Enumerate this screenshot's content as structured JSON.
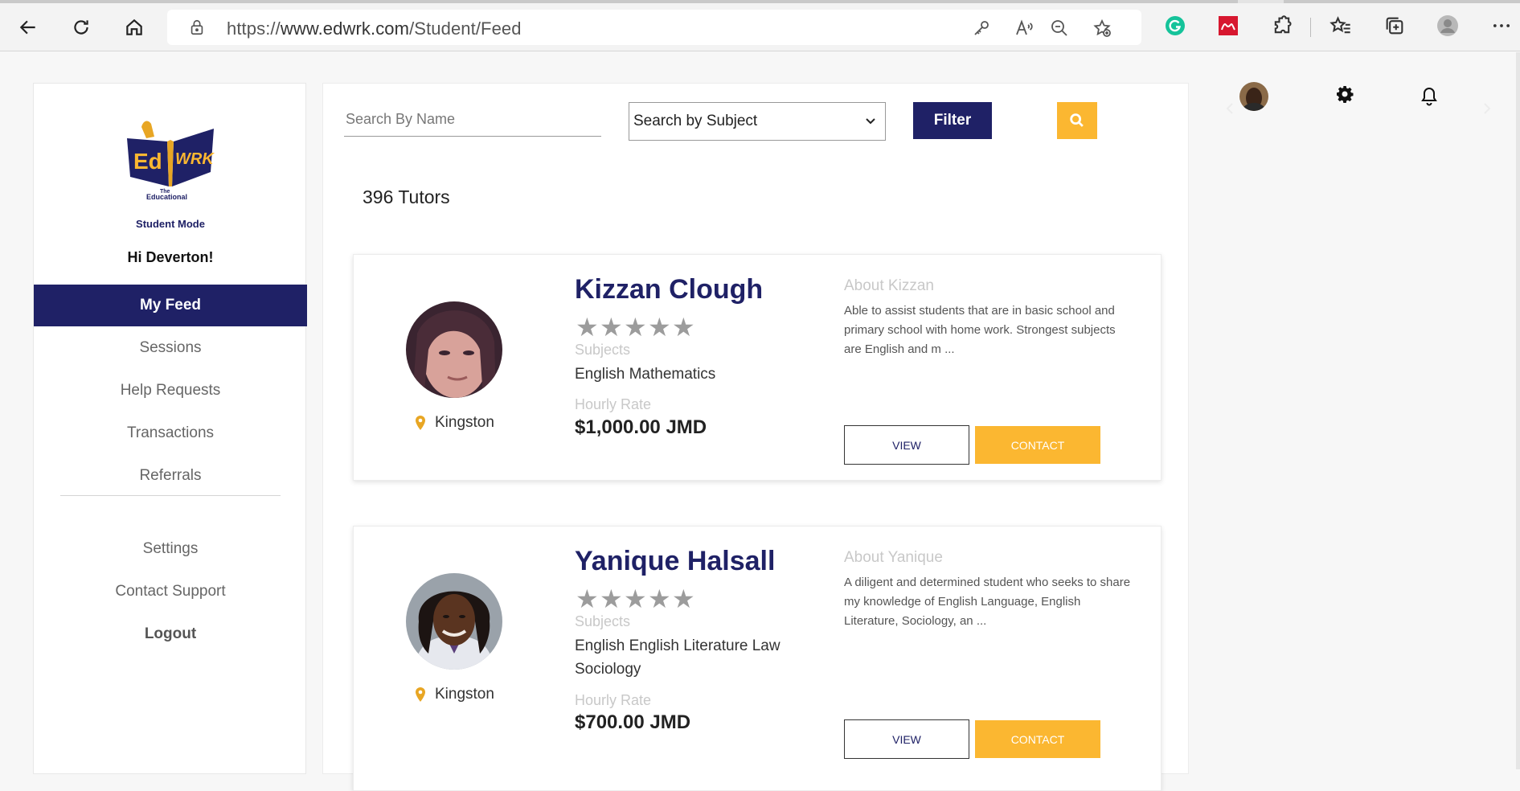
{
  "browser": {
    "url_prefix": "https://",
    "url_host": "www.edwrk.com",
    "url_path": "/Student/Feed"
  },
  "sidebar": {
    "mode_label": "Student Mode",
    "greeting": "Hi Deverton!",
    "items": [
      {
        "label": "My Feed"
      },
      {
        "label": "Sessions"
      },
      {
        "label": "Help Requests"
      },
      {
        "label": "Transactions"
      },
      {
        "label": "Referrals"
      },
      {
        "label": "Settings"
      },
      {
        "label": "Contact Support"
      },
      {
        "label": "Logout"
      }
    ]
  },
  "toolbar": {
    "name_placeholder": "Search By Name",
    "subject_value": "Search by Subject",
    "filter_label": "Filter"
  },
  "feed": {
    "count_label": "396 Tutors",
    "tutors": [
      {
        "name": "Kizzan Clough",
        "rating": 0,
        "subjects_label": "Subjects",
        "subjects": "English Mathematics",
        "rate_label": "Hourly Rate",
        "rate": "$1,000.00 JMD",
        "about_title": "About Kizzan",
        "about": "Able to assist students that are in basic school and primary school with home work. Strongest subjects are English and m ...",
        "location": "Kingston",
        "view_label": "VIEW",
        "contact_label": "CONTACT"
      },
      {
        "name": "Yanique Halsall",
        "rating": 0,
        "subjects_label": "Subjects",
        "subjects": "English English Literature Law Sociology",
        "rate_label": "Hourly Rate",
        "rate": "$700.00 JMD",
        "about_title": "About Yanique",
        "about": "A diligent and determined student who seeks to share my knowledge of English Language, English Literature, Sociology, an ...",
        "location": "Kingston",
        "view_label": "VIEW",
        "contact_label": "CONTACT"
      }
    ]
  },
  "colors": {
    "brand_navy": "#1f2166",
    "accent_yellow": "#fbb731"
  }
}
